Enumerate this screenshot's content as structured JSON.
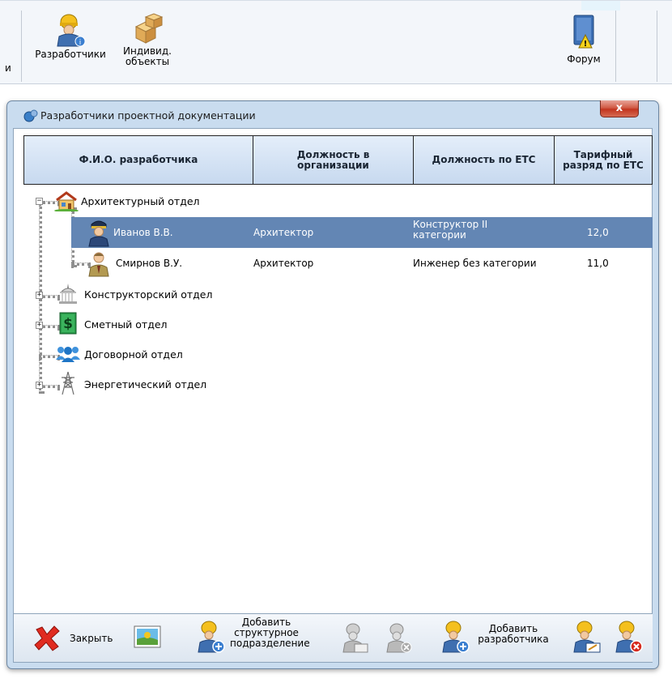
{
  "toolbar": {
    "cut_label": "и",
    "developers_label": "Разработчики",
    "objects_label_1": "Индивид.",
    "objects_label_2": "объекты",
    "forum_label": "Форум"
  },
  "dialog": {
    "title": "Разработчики проектной документации",
    "close_label": "x"
  },
  "grid": {
    "headers": [
      "Ф.И.О. разработчика",
      "Должность в организации",
      "Должность по ЕТС",
      "Тарифный разряд по ЕТС"
    ],
    "groups": [
      "Архитектурный отдел",
      "Конструкторский отдел",
      "Сметный отдел",
      "Договорной отдел",
      "Энергетический отдел"
    ],
    "rows": [
      {
        "name": "Иванов В.В.",
        "position": "Архитектор",
        "ets_1": "Конструктор II",
        "ets_2": "категории",
        "grade": "12,0"
      },
      {
        "name": "Смирнов В.У.",
        "position": "Архитектор",
        "ets_1": "Инженер без категории",
        "ets_2": "",
        "grade": "11,0"
      }
    ]
  },
  "bottom": {
    "close_label": "Закрыть",
    "add_unit_1": "Добавить",
    "add_unit_2": "структурное",
    "add_unit_3": "подразделение",
    "add_dev_1": "Добавить",
    "add_dev_2": "разработчика"
  },
  "colors": {
    "selection": "#6386b4",
    "dialog_frame": "#c9dcef",
    "close_red": "#c2351f"
  }
}
